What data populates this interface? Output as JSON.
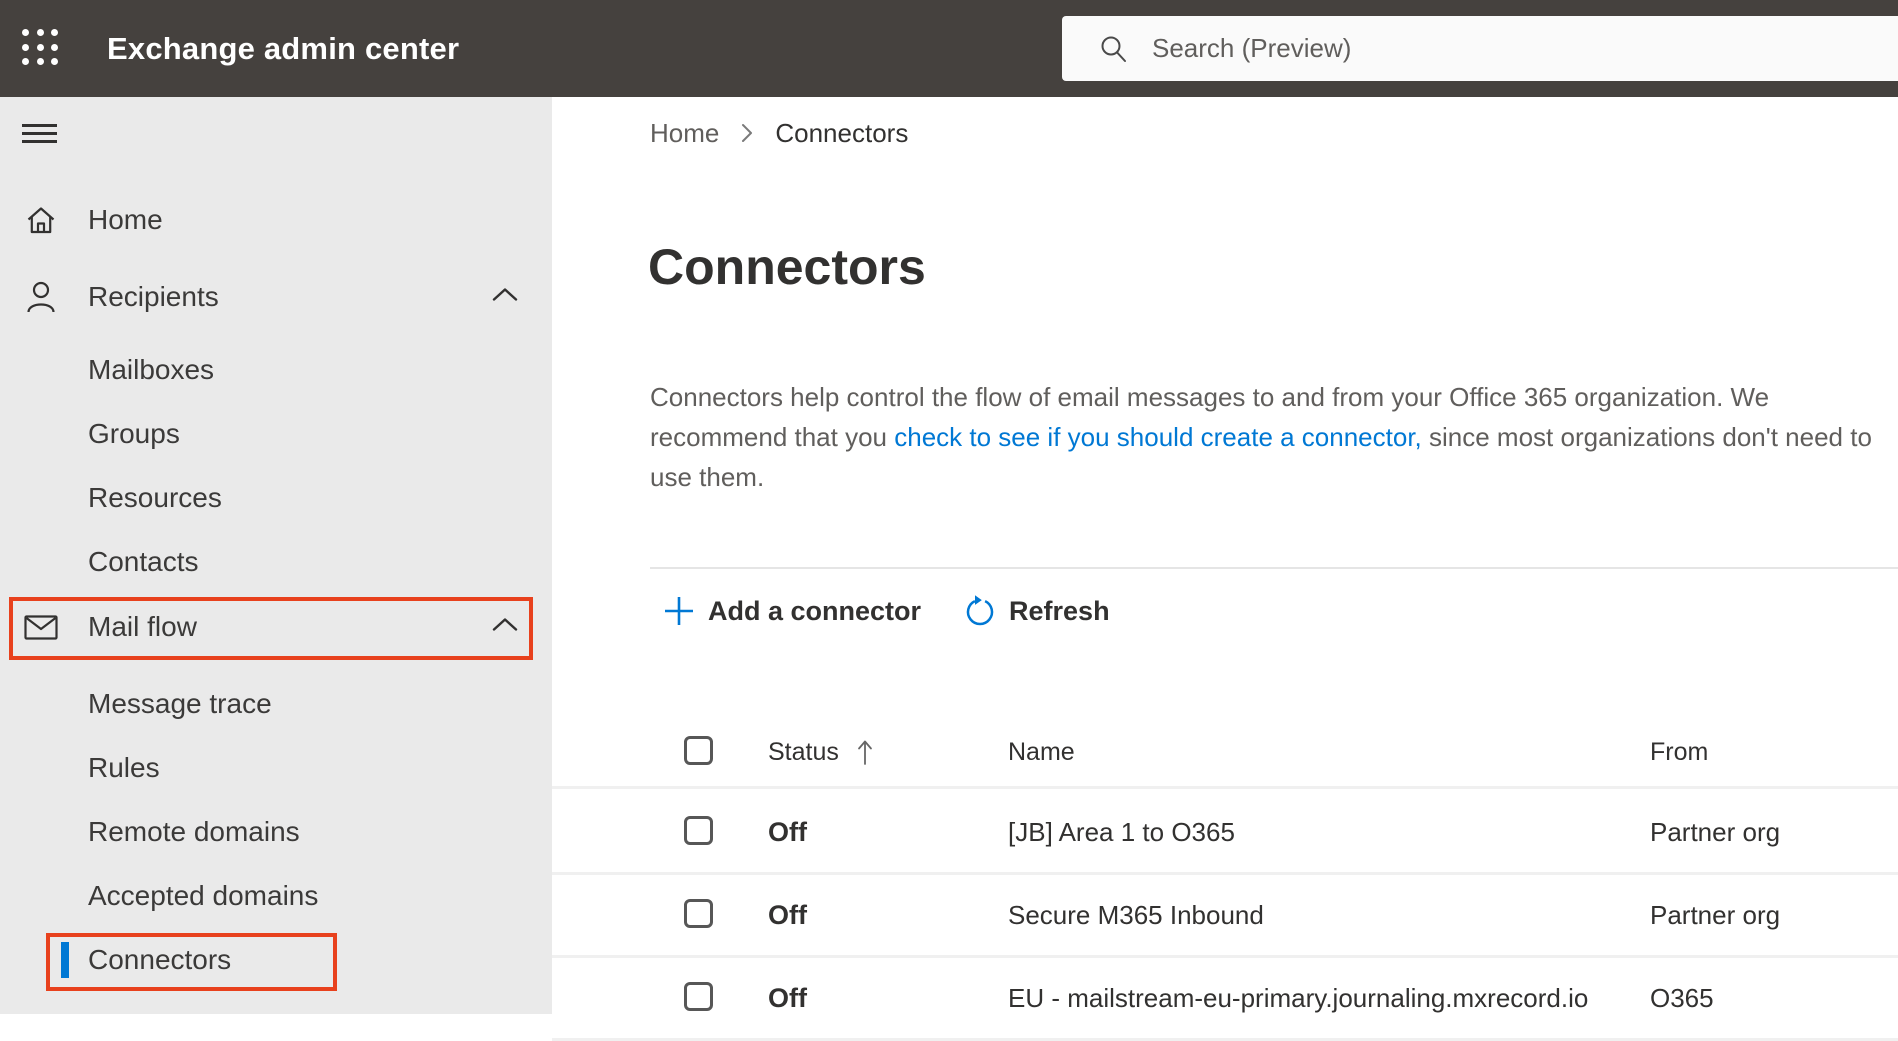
{
  "topbar": {
    "title": "Exchange admin center",
    "search_placeholder": "Search (Preview)"
  },
  "sidebar": {
    "items": [
      {
        "label": "Home",
        "icon": "home-icon",
        "type": "top"
      },
      {
        "label": "Recipients",
        "icon": "person-icon",
        "type": "top",
        "expanded": true
      },
      {
        "label": "Mailboxes",
        "type": "sub"
      },
      {
        "label": "Groups",
        "type": "sub"
      },
      {
        "label": "Resources",
        "type": "sub"
      },
      {
        "label": "Contacts",
        "type": "sub"
      },
      {
        "label": "Mail flow",
        "icon": "mail-icon",
        "type": "top",
        "expanded": true,
        "annotated": true
      },
      {
        "label": "Message trace",
        "type": "sub"
      },
      {
        "label": "Rules",
        "type": "sub"
      },
      {
        "label": "Remote domains",
        "type": "sub"
      },
      {
        "label": "Accepted domains",
        "type": "sub"
      },
      {
        "label": "Connectors",
        "type": "sub",
        "selected": true,
        "annotated": true
      }
    ]
  },
  "breadcrumb": {
    "home": "Home",
    "current": "Connectors"
  },
  "page": {
    "title": "Connectors",
    "description_before_link": "Connectors help control the flow of email messages to and from your Office 365 organization. We recommend that you ",
    "description_link": "check to see if you should create a connector,",
    "description_after_link": " since most organizations don't need to use them."
  },
  "toolbar": {
    "add_label": "Add a connector",
    "refresh_label": "Refresh"
  },
  "table": {
    "headers": {
      "status": "Status",
      "name": "Name",
      "from": "From"
    },
    "sort": {
      "column": "Status",
      "direction": "ascending"
    },
    "rows": [
      {
        "status": "Off",
        "name": "[JB] Area 1 to O365",
        "from": "Partner org"
      },
      {
        "status": "Off",
        "name": "Secure M365 Inbound",
        "from": "Partner org"
      },
      {
        "status": "Off",
        "name": "EU - mailstream-eu-primary.journaling.mxrecord.io",
        "from": "O365"
      }
    ]
  },
  "colors": {
    "accent_blue": "#0078d4",
    "annotation_red": "#e8411d",
    "topbar_bg": "#45413e",
    "sidebar_bg": "#eaeaea"
  }
}
